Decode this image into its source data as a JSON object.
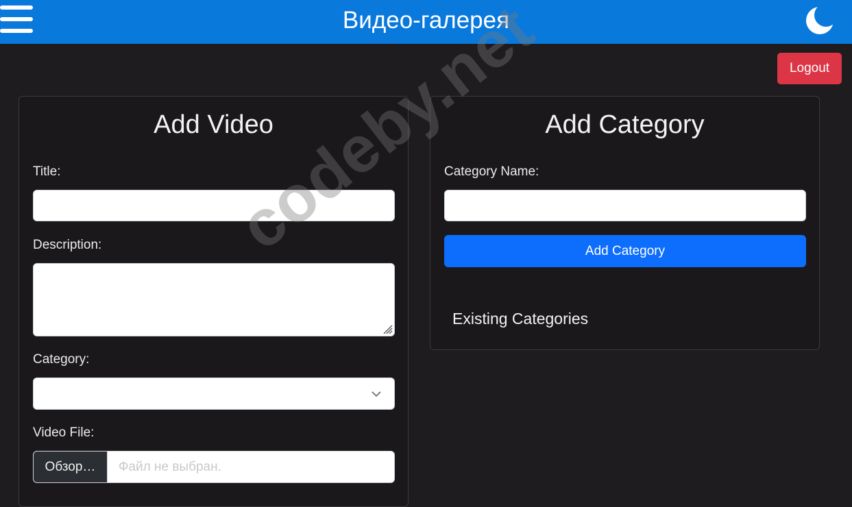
{
  "header": {
    "title": "Видео-галерея",
    "menu_icon": "hamburger-menu-icon",
    "theme_icon": "moon-icon"
  },
  "logout_label": "Logout",
  "add_video": {
    "title": "Add Video",
    "title_label": "Title:",
    "title_value": "",
    "description_label": "Description:",
    "description_value": "",
    "category_label": "Category:",
    "category_selected": "",
    "video_file_label": "Video File:",
    "browse_label": "Обзор…",
    "file_status": "Файл не выбран."
  },
  "add_category": {
    "title": "Add Category",
    "name_label": "Category Name:",
    "name_value": "",
    "button_label": "Add Category",
    "existing_heading": "Existing Categories"
  },
  "watermark": "codeby.net",
  "colors": {
    "header_bg": "#0a79dc",
    "page_bg": "#1f1c1f",
    "danger": "#dc3545",
    "primary": "#0d6efd"
  }
}
